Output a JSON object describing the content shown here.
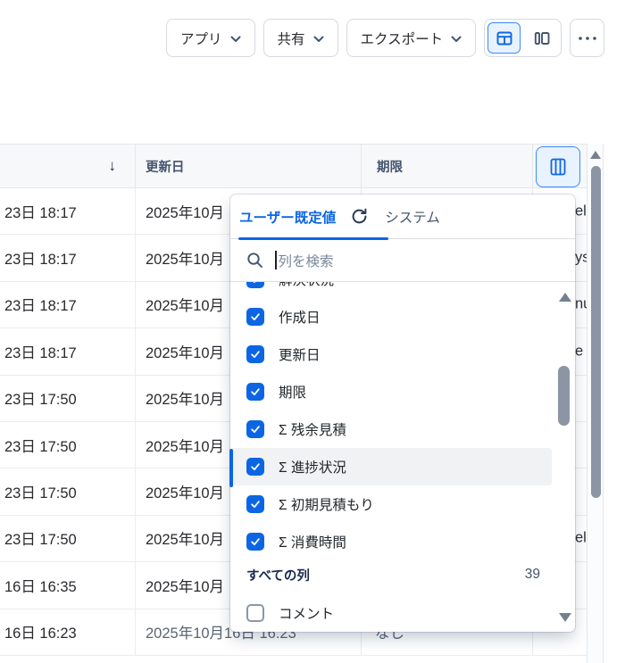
{
  "colors": {
    "accent_blue": "#0C66E4",
    "selected_bg": "#E9F2FF",
    "selected_border": "#388BFF",
    "header_bg": "#F7F8F9",
    "highlight_row": "#F1F2F4",
    "scroll_thumb": "#8C95A3"
  },
  "toolbar": {
    "apps_label": "アプリ",
    "share_label": "共有",
    "export_label": "エクスポート"
  },
  "table": {
    "sort_indicator": "↓",
    "columns": {
      "col2": "更新日",
      "col3": "期限"
    },
    "rows": [
      {
        "time": "23日 18:17",
        "updated": "2025年10月",
        "due": "",
        "tail": "el"
      },
      {
        "time": "23日 18:17",
        "updated": "2025年10月",
        "due": "",
        "tail": "ys"
      },
      {
        "time": "23日 18:17",
        "updated": "2025年10月",
        "due": "",
        "tail": "nu"
      },
      {
        "time": "23日 18:17",
        "updated": "2025年10月",
        "due": "",
        "tail": "e"
      },
      {
        "time": "23日 17:50",
        "updated": "2025年10月",
        "due": "",
        "tail": ""
      },
      {
        "time": "23日 17:50",
        "updated": "2025年10月",
        "due": "",
        "tail": ""
      },
      {
        "time": "23日 17:50",
        "updated": "2025年10月",
        "due": "",
        "tail": ""
      },
      {
        "time": "23日 17:50",
        "updated": "2025年10月",
        "due": "",
        "tail": "el"
      },
      {
        "time": "16日 16:35",
        "updated": "2025年10月",
        "due": "",
        "tail": ""
      },
      {
        "time": "16日 16:23",
        "updated": "2025年10月16日 16:23",
        "due": "なし",
        "tail": ""
      }
    ]
  },
  "column_picker": {
    "tabs": {
      "user_default": "ユーザー既定値",
      "system": "システム"
    },
    "search_placeholder": "列を検索",
    "items": [
      {
        "label": "解決状況",
        "checked": true
      },
      {
        "label": "作成日",
        "checked": true
      },
      {
        "label": "更新日",
        "checked": true
      },
      {
        "label": "期限",
        "checked": true
      },
      {
        "label": "Σ 残余見積",
        "checked": true
      },
      {
        "label": "Σ 進捗状況",
        "checked": true
      },
      {
        "label": "Σ 初期見積もり",
        "checked": true
      },
      {
        "label": "Σ 消費時間",
        "checked": true
      },
      {
        "label": "コメント",
        "checked": false
      }
    ],
    "section": {
      "label": "すべての列",
      "count": "39"
    }
  }
}
